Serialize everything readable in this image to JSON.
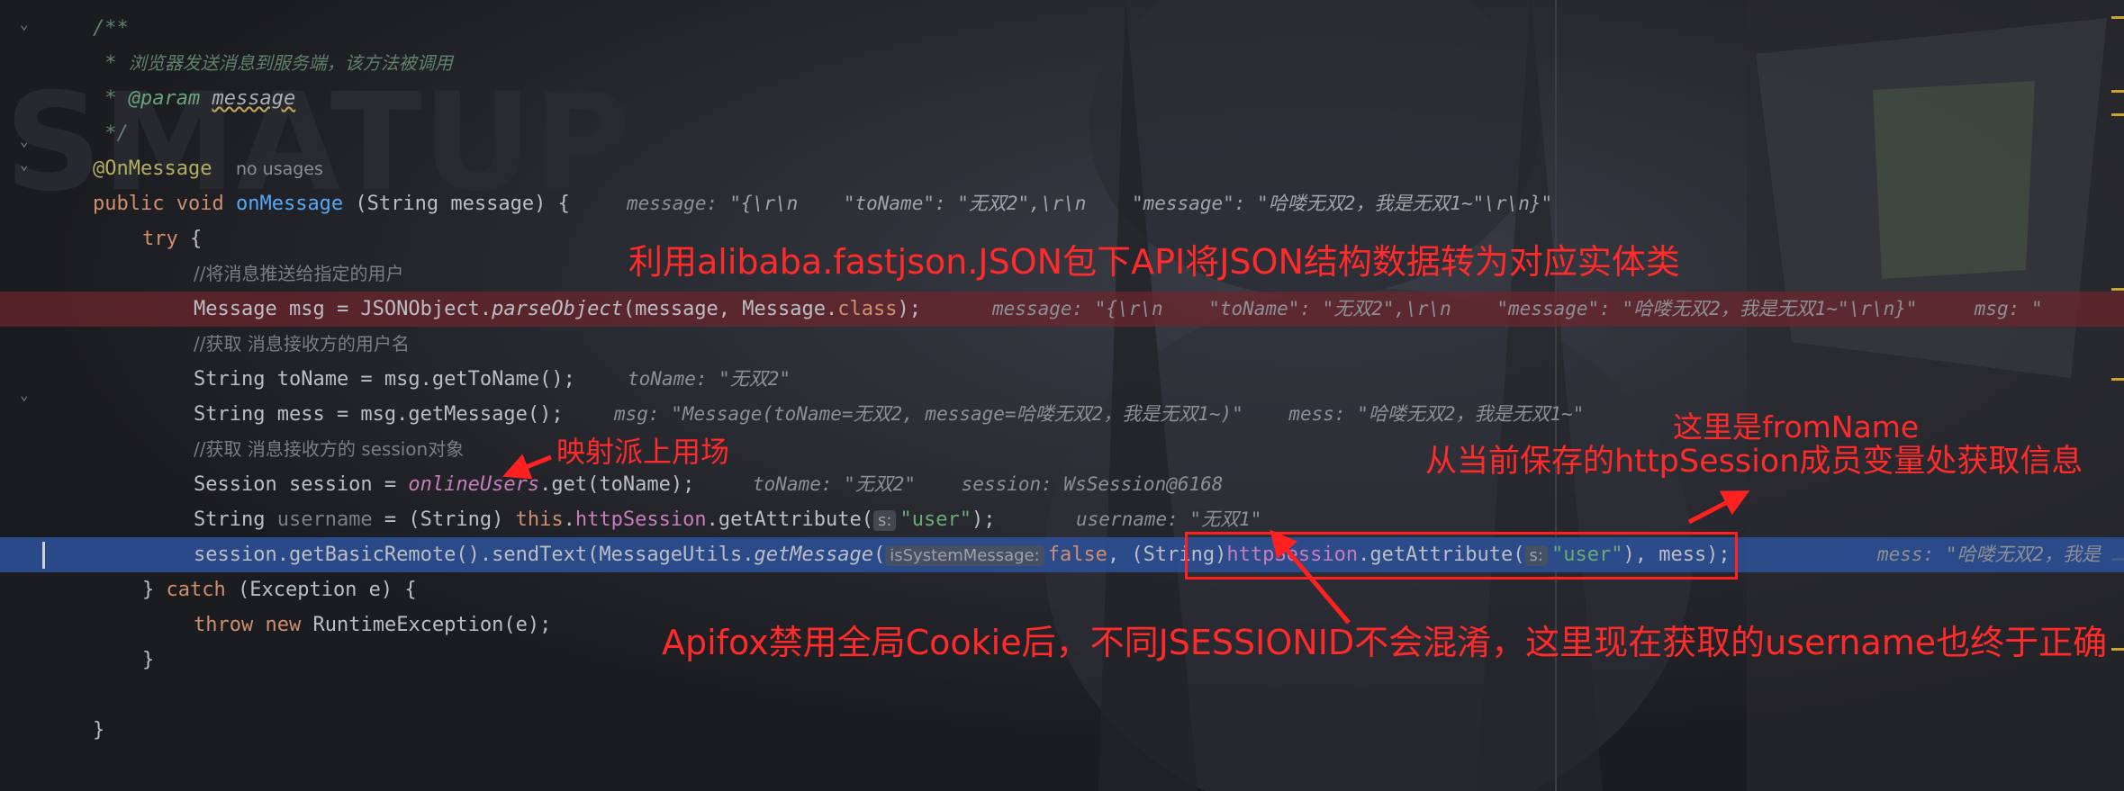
{
  "code_lines": {
    "l1": "/**",
    "l2_star": " * ",
    "l2_text": "浏览器发送消息到服务端，该方法被调用",
    "l3_star": " * ",
    "l3_tag": "@param",
    "l3_param": "message",
    "l4": " */",
    "l5_annotation": "@OnMessage",
    "l5_usages": "no usages",
    "l6_public": "public",
    "l6_void": "void",
    "l6_method": "onMessage",
    "l6_rest": " (String message) {",
    "l6_dbg_key": "message:",
    "l6_dbg_val": "\"{\\r\\n    \"toName\": \"无双2\",\\r\\n    \"message\": \"哈喽无双2，我是无双1~\"\\r\\n}\"",
    "l7_try": "try",
    "l7_rest": " {",
    "l8_comment": "//将消息推送给指定的用户",
    "l9_a": "Message msg = JSONObject.",
    "l9_method": "parseObject",
    "l9_b": "(message, Message.",
    "l9_class": "class",
    "l9_c": ");",
    "l9_dbg": "message: \"{\\r\\n    \"toName\": \"无双2\",\\r\\n    \"message\": \"哈喽无双2，我是无双1~\"\\r\\n}\"     msg: \"",
    "l10_comment": "//获取 消息接收方的用户名",
    "l11_code": "String toName = msg.getToName();",
    "l11_dbg": "toName: \"无双2\"",
    "l12_code": "String mess = msg.getMessage();",
    "l12_dbg": "msg: \"Message(toName=无双2, message=哈喽无双2，我是无双1~)\"    mess: \"哈喽无双2，我是无双1~\"",
    "l13_comment": "//获取 消息接收方的 session对象",
    "l14_a": "Session session = ",
    "l14_field": "onlineUsers",
    "l14_b": ".get(toName);",
    "l14_dbg": "toName: \"无双2\"    session: WsSession@6168",
    "l15_a": "String ",
    "l15_var": "username",
    "l15_b": " = (String) ",
    "l15_this": "this",
    "l15_dot": ".",
    "l15_field": "httpSession",
    "l15_c": ".getAttribute(",
    "l15_hint": "s:",
    "l15_str": "\"user\"",
    "l15_d": ");",
    "l15_dbg": "username: \"无双1\"",
    "l16_a": "session.getBasicRemote().sendText(MessageUtils.",
    "l16_method": "getMessage",
    "l16_b": "(",
    "l16_hint1": "isSystemMessage:",
    "l16_false": "false",
    "l16_c": ", (String)",
    "l16_field": "httpSession",
    "l16_d": ".getAttribute(",
    "l16_hint2": "s:",
    "l16_str": "\"user\"",
    "l16_e": "), mess);",
    "l16_dbg": "mess: \"哈喽无双2，我是",
    "l17_a": "} ",
    "l17_catch": "catch",
    "l17_b": " (Exception e) {",
    "l18_throw": "throw",
    "l18_new": "new",
    "l18_rest": " RuntimeException(e);",
    "l19": "}",
    "l21": "}"
  },
  "annotations": {
    "fastjson": "利用alibaba.fastjson.JSON包下API将JSON结构数据转为对应实体类",
    "field_use": "映射派上用场",
    "from_name_1": "这里是fromName",
    "from_name_2": "从当前保存的httpSession成员变量处获取信息",
    "apifox": "Apifox禁用全局Cookie后，不同JSESSIONID不会混淆，这里现在获取的username也终于正确"
  },
  "gutter_icons": {
    "fold": "fold-chevron-icon"
  },
  "colors": {
    "annotation_red": "#ff2a2a",
    "execution_line": "#2c5096",
    "breakpoint_line": "#6e262c"
  }
}
